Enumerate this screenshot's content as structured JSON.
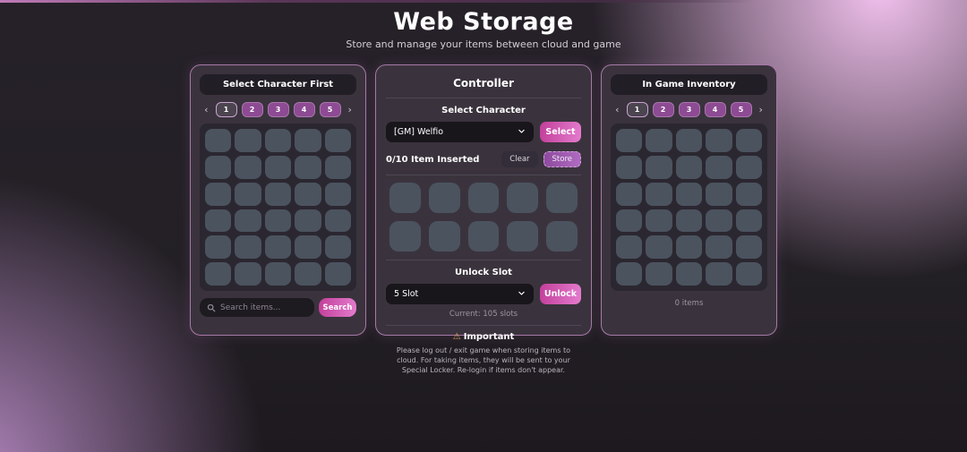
{
  "page": {
    "title": "Web Storage",
    "subtitle": "Store and manage your items between cloud and game"
  },
  "colors": {
    "accent_pink": "#d24aa4",
    "accent_purple": "#8d4b93",
    "slot": "#4b535f",
    "panel_border": "#a778a8",
    "warning_icon": "#e0a55a"
  },
  "cloud_panel": {
    "header": "Select Character First",
    "pagination": {
      "prev_icon": "‹",
      "next_icon": "›",
      "pages": [
        "1",
        "2",
        "3",
        "4",
        "5"
      ],
      "active": "1"
    },
    "grid": {
      "cols": 5,
      "rows": 6
    },
    "search": {
      "placeholder": "Search items...",
      "button_label": "Search"
    }
  },
  "controller_panel": {
    "title": "Controller",
    "select_character": {
      "label": "Select Character",
      "selected_option": "[GM] Welfio",
      "chevron_icon": "⌄",
      "button_label": "Select"
    },
    "insert": {
      "label": "0/10 Item Inserted",
      "clear_label": "Clear",
      "store_label": "Store",
      "grid": {
        "cols": 5,
        "rows": 2
      }
    },
    "unlock": {
      "label": "Unlock Slot",
      "selected_option": "5 Slot",
      "chevron_icon": "⌄",
      "button_label": "Unlock",
      "current": "Current: 105 slots"
    },
    "important": {
      "icon": "⚠",
      "title": "Important",
      "text": "Please log out / exit game when storing items to cloud. For taking items, they will be sent to your Special Locker. Re-login if items don't appear."
    }
  },
  "inventory_panel": {
    "header": "In Game Inventory",
    "pagination": {
      "prev_icon": "‹",
      "next_icon": "›",
      "pages": [
        "1",
        "2",
        "3",
        "4",
        "5"
      ],
      "active": "1"
    },
    "grid": {
      "cols": 5,
      "rows": 6
    },
    "footer": "0 items"
  }
}
